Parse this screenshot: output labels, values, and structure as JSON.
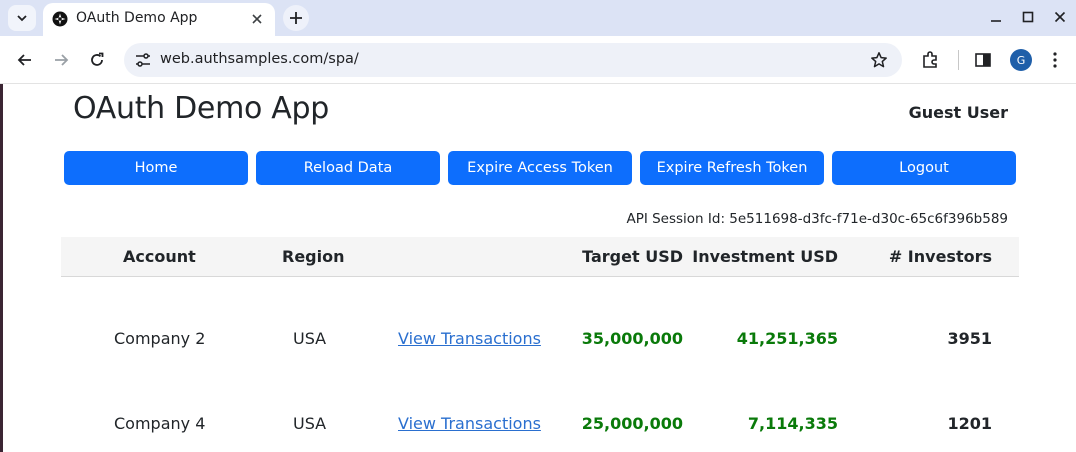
{
  "browser": {
    "tab_title": "OAuth Demo App",
    "url": "web.authsamples.com/spa/",
    "profile_initial": "G",
    "icons": [
      "tab-search-icon",
      "app-favicon",
      "close-tab-icon",
      "new-tab-icon",
      "minimize-icon",
      "maximize-icon",
      "close-window-icon",
      "back-icon",
      "forward-icon",
      "reload-icon",
      "site-info-icon",
      "bookmark-star-icon",
      "extensions-icon",
      "side-panel-icon",
      "menu-icon"
    ]
  },
  "app": {
    "title": "OAuth Demo App",
    "user": "Guest User",
    "buttons": {
      "home": "Home",
      "reload": "Reload Data",
      "expire_access": "Expire Access Token",
      "expire_refresh": "Expire Refresh Token",
      "logout": "Logout"
    },
    "session": "API Session Id: 5e511698-d3fc-f71e-d30c-65c6f396b589",
    "colors": {
      "primary": "#0d6efd",
      "positive": "#0a7a0a",
      "link": "#2a6fcf"
    }
  },
  "table": {
    "headers": {
      "account": "Account",
      "region": "Region",
      "target": "Target USD",
      "investment": "Investment USD",
      "investors": "# Investors"
    },
    "rows": [
      {
        "account": "Company 2",
        "region": "USA",
        "link": "View Transactions",
        "target": "35,000,000",
        "investment": "41,251,365",
        "investors": "3951"
      },
      {
        "account": "Company 4",
        "region": "USA",
        "link": "View Transactions",
        "target": "25,000,000",
        "investment": "7,114,335",
        "investors": "1201"
      }
    ]
  }
}
